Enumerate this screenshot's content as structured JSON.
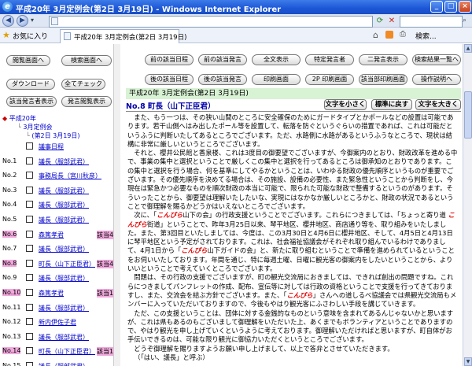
{
  "window": {
    "title": "平成20年 3月定例会(第2日 3月19日) - Windows Internet Explorer"
  },
  "favorites": {
    "label": "お気に入り",
    "tab_title": "平成20年 3月定例会(第2日 3月19日)",
    "page_menu": "検索..."
  },
  "left": {
    "btn_toc": "閲覧画面へ",
    "btn_search": "検索画面へ",
    "btn_download": "ダウンロード",
    "btn_checkall": "全てチェック",
    "btn_showspeakers": "該当発言者表示",
    "btn_hidespeakers": "発言閲覧表示",
    "tree": {
      "year": "平成20年",
      "session": "3月定例会",
      "day": "(第2日 3月19日)"
    },
    "speakers": [
      {
        "no": "",
        "name": "議事日程",
        "hl": false,
        "ann": ""
      },
      {
        "no": "No.1",
        "name": "議長（服部武君）",
        "hl": false,
        "ann": ""
      },
      {
        "no": "No.2",
        "name": "事務局長（宮川秋彦）",
        "hl": false,
        "ann": ""
      },
      {
        "no": "No.3",
        "name": "議長（服部武君）",
        "hl": false,
        "ann": ""
      },
      {
        "no": "No.4",
        "name": "議長（服部武君）",
        "hl": false,
        "ann": ""
      },
      {
        "no": "No.5",
        "name": "議長（服部武君）",
        "hl": false,
        "ann": ""
      },
      {
        "no": "No.6",
        "name": "森篤孝君",
        "hl": true,
        "ann": "該当4"
      },
      {
        "no": "No.7",
        "name": "議長（服部武君）",
        "hl": false,
        "ann": ""
      },
      {
        "no": "No.8",
        "name": "町長（山下正臣君）",
        "hl": true,
        "ann": "該当4"
      },
      {
        "no": "No.9",
        "name": "議長（服部武君）",
        "hl": false,
        "ann": ""
      },
      {
        "no": "No.10",
        "name": "森篤孝君",
        "hl": true,
        "ann": "該当1"
      },
      {
        "no": "No.11",
        "name": "議長（服部武君）",
        "hl": false,
        "ann": ""
      },
      {
        "no": "No.12",
        "name": "新内伊佐子君",
        "hl": false,
        "ann": ""
      },
      {
        "no": "No.13",
        "name": "議長（服部武君）",
        "hl": false,
        "ann": ""
      },
      {
        "no": "No.14",
        "name": "町長（山下正臣君）",
        "hl": true,
        "ann": "該当1"
      },
      {
        "no": "No.15",
        "name": "議長（服部武君）",
        "hl": false,
        "ann": ""
      }
    ]
  },
  "right": {
    "buttons_row1": [
      "前の該当日程",
      "前の該当発言",
      "全文表示",
      "特定発言者",
      "二発言表示",
      "検索結果一覧へ"
    ],
    "buttons_row2": [
      "後の該当日程",
      "後の該当発言",
      "印刷画面",
      "2P 印刷画面",
      "該当部印刷画面",
      "操作説明へ"
    ],
    "date_line": "平成20年 3月定例会(第2日 3月19日)",
    "speaker": "No.8 町長（山下正臣君）",
    "size_small": "文字を小さく",
    "size_reset": "標準に戻す",
    "size_large": "文字を大きく",
    "paragraphs": [
      "また、もう一つは、その狭い山間のところに安全確保のためにガードタイプとかポールなどの設置は可能であります。若干山側へはみ出したポール等を設置して、転落を防ぐというぐらいの措置であれば、これは可能だというふうに判断いたしてあるところでございます。ただ、水路側に水路があるというふうなところで、現状は結構に非常に厳しいというところでございます。",
      "それと、櫻井公民館と香泉楼、これは3度目の御要望でございますが、今御案内のとおり、財政改革を進める中で、事業の集中と選択ということで厳しくこの集中と選択を行ってあるところは御承知のとおりであります。この集中と選択を行う場合、何を基準にしてやるかということは、いわゆる財政の優先順序というものが重要でございます。その優先順序を決めてる場合は、その施設、設備の必要性、また緊急性ということから判断をし、今現在は緊急かつ必要なものを順次財政の本当に可能で、限られた可能な財政で整備するというのがあります。そういったことから、御要望は理解いたしたいな、実現にはなかなか厳しいところかと、財政の状況であるということで御理解を賜るかどうかはいえないところでございます。",
      "次に、「こんぴら山下の会」の行政支援ということでございます。これらにつきましては、「ちょっと寄り道 こんぴら街道」ということで、昨年3月25日以来、琴平地区、櫻井地区、商店通り等を、取り組みをいたしました。また、第3回目といたしましては、今度は、この3月30日と4月6日に櫻井地区、そして、4月5日と4月13日に琴平地区という予定がされております。これは、社会福祉協議会がそれぞれ取り組んでいるわけでありまして、4月1日から「こんぴら山下ガイドの会」と、新たに取り組むということで準備を進められているということをお伺いいたしております。年間を通じ、特に毎週土曜、日曜に観光客の御案内をしたいということから、よりいいということで考えていくところでございます。",
      "問題は、その行政の支援でございますが、町の観光交流局におきましては、できれば創出の問題ですね。これらにつきましてパンフレットの作成、配布、宣伝等に対しては行政の資格ということで支援を行ってきておりますし、また、交流会を結ぶ方針でございます。また、「こんぴら」さんへの道しるべ協議会では県観光交流局もメンバーに入っていただいておりますので、今後もやはり観光客にふさわしい手段を講じていきます。",
      "ただ、この支援ということは、団体に対する金銭的なものという意味を含まれてあるんじゃないかと思いますが、これは県もあるのもございまして御理解をいただいた上、あくまでもボランティアということでありますので、やはり観光を申し上げていくというように考えております。御理解いただければと思いますが、町自体がお手伝いできるのは、可能な限り観光に御協力いただくというところでございます。",
      "どうぞ御理解を賜りますようお願い申し上げまして、以上で答弁とさせていただきます。"
    ],
    "last_line": "（「はい、議長」と呼ぶ）"
  }
}
